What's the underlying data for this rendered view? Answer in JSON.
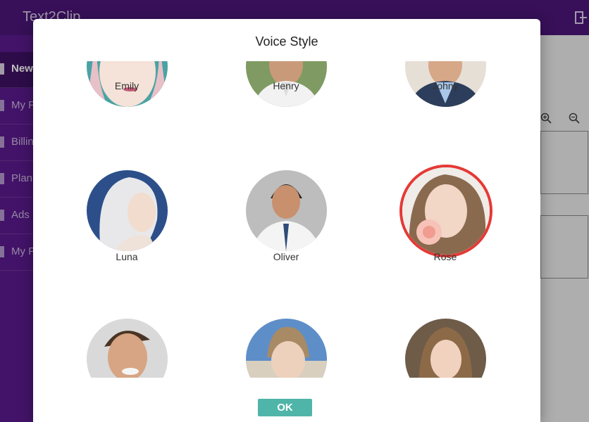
{
  "app": {
    "title": "Text2Clip",
    "logout_icon": "logout-icon"
  },
  "sidebar": {
    "items": [
      {
        "label": "New",
        "active": true
      },
      {
        "label": "My P"
      },
      {
        "label": "Billin"
      },
      {
        "label": "Plan"
      },
      {
        "label": "Ads"
      },
      {
        "label": "My P"
      }
    ]
  },
  "dialog": {
    "title": "Voice Style",
    "ok_label": "OK",
    "voices": [
      {
        "name": "Emily"
      },
      {
        "name": "Henry"
      },
      {
        "name": "Johny"
      },
      {
        "name": "Luna"
      },
      {
        "name": "Oliver"
      },
      {
        "name": "Rose",
        "selected": true
      },
      {
        "name": ""
      },
      {
        "name": ""
      },
      {
        "name": ""
      }
    ]
  },
  "colors": {
    "accent_purple": "#4a1677",
    "selected_ring": "#e53935",
    "ok_button": "#4fb5a8"
  }
}
